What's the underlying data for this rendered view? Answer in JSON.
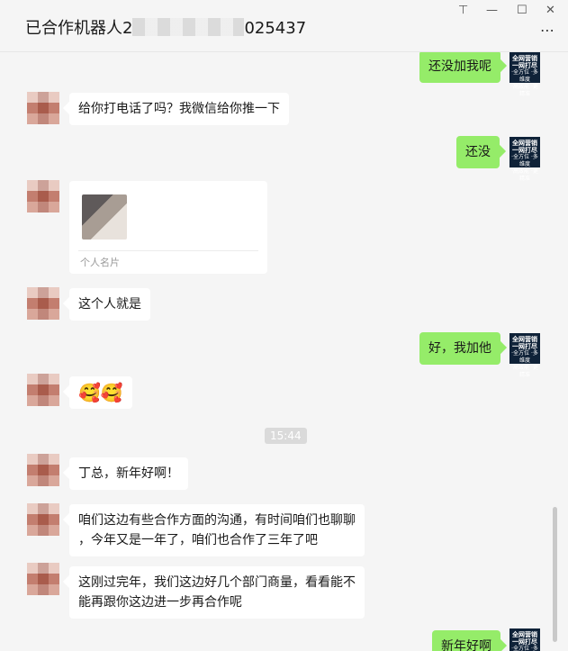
{
  "window": {
    "title_prefix": "已合作机器人2",
    "title_suffix": "025437",
    "controls": {
      "pin": "⊤",
      "minimize": "—",
      "maximize": "☐",
      "close": "✕"
    },
    "more": "⋯"
  },
  "chat": {
    "messages": [
      {
        "side": "right",
        "text": "还没加我呢"
      },
      {
        "side": "left",
        "text": "给你打电话了吗？我微信给你推一下"
      },
      {
        "side": "right",
        "text": "还没"
      },
      {
        "side": "left",
        "type": "card",
        "card_label": "个人名片"
      },
      {
        "side": "left",
        "text": "这个人就是"
      },
      {
        "side": "right",
        "text": "好，我加他"
      },
      {
        "side": "left",
        "type": "emoji",
        "text": "🥰🥰"
      },
      {
        "type": "time",
        "text": "15:44"
      },
      {
        "side": "left",
        "text": "丁总，新年好啊！"
      },
      {
        "side": "left",
        "text": "咱们这边有些合作方面的沟通，有时间咱们也聊聊\n，今年又是一年了，咱们也合作了三年了吧"
      },
      {
        "side": "left",
        "text": "这刚过完年，我们这边好几个部门商量，看看能不\n能再跟你这边进一步再合作呢"
      },
      {
        "side": "right",
        "text": "新年好啊"
      }
    ],
    "self_avatar": {
      "line1": "全网营销",
      "line2": "一网打尽",
      "line3": "·全方位 ·多维度",
      "line4": "·高效能 ·更精准"
    }
  }
}
